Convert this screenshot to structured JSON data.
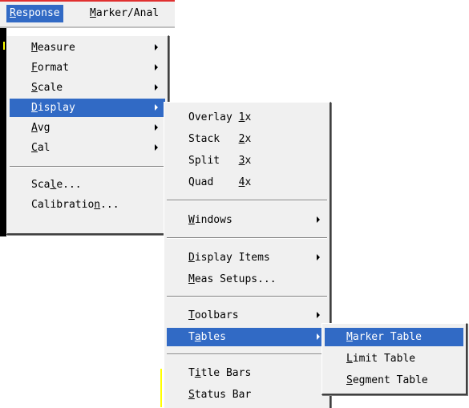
{
  "menubar": {
    "items": [
      {
        "label": "Response",
        "active": true
      },
      {
        "label": "Marker/Anal",
        "active": false
      }
    ]
  },
  "response_menu": {
    "items": [
      {
        "label": "Measure",
        "submenu": true
      },
      {
        "label": "Format",
        "submenu": true
      },
      {
        "label": "Scale",
        "submenu": true
      },
      {
        "label": "Display",
        "submenu": true,
        "selected": true
      },
      {
        "label": "Avg",
        "submenu": true
      },
      {
        "label": "Cal",
        "submenu": true
      },
      {
        "label": "Scale...",
        "submenu": false
      },
      {
        "label": "Calibration...",
        "submenu": false
      }
    ]
  },
  "display_menu": {
    "items": [
      {
        "label": "Overlay",
        "shortcut": "1x"
      },
      {
        "label": "Stack",
        "shortcut": "2x"
      },
      {
        "label": "Split",
        "shortcut": "3x"
      },
      {
        "label": "Quad",
        "shortcut": "4x"
      },
      {
        "label": "Windows",
        "submenu": true
      },
      {
        "label": "Display Items",
        "submenu": true
      },
      {
        "label": "Meas Setups..."
      },
      {
        "label": "Toolbars",
        "submenu": true
      },
      {
        "label": "Tables",
        "submenu": true,
        "selected": true
      },
      {
        "label": "Title Bars"
      },
      {
        "label": "Status Bar"
      }
    ]
  },
  "tables_menu": {
    "items": [
      {
        "label": "Marker Table",
        "selected": true
      },
      {
        "label": "Limit Table"
      },
      {
        "label": "Segment Table"
      }
    ]
  },
  "colors": {
    "highlight": "#316ac5",
    "menu_bg": "#f0f0f0"
  }
}
